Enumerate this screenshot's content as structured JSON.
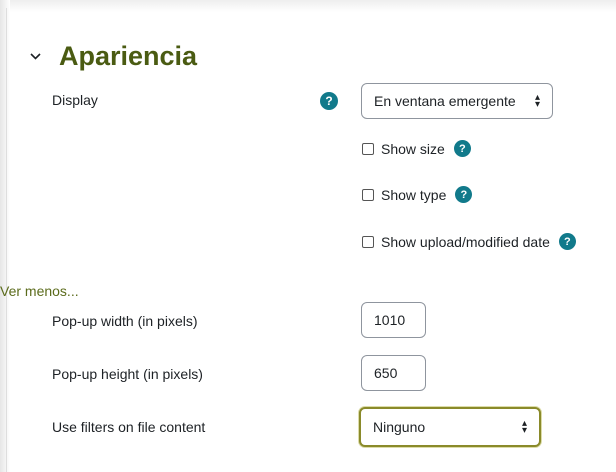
{
  "section": {
    "title": "Apariencia",
    "icon": "chevron-down-icon"
  },
  "display": {
    "label": "Display",
    "value": "En ventana emergente"
  },
  "checkboxes": [
    {
      "label": "Show size",
      "checked": false
    },
    {
      "label": "Show type",
      "checked": false
    },
    {
      "label": "Show upload/modified date",
      "checked": false
    }
  ],
  "toggle": {
    "label": "Ver menos..."
  },
  "popup_width": {
    "label": "Pop-up width (in pixels)",
    "value": "1010"
  },
  "popup_height": {
    "label": "Pop-up height (in pixels)",
    "value": "650"
  },
  "filters": {
    "label": "Use filters on file content",
    "value": "Ninguno"
  },
  "help_glyph": "?",
  "colors": {
    "title": "#4a5b12",
    "help": "#117a8b",
    "focus": "#8a8a2a"
  }
}
